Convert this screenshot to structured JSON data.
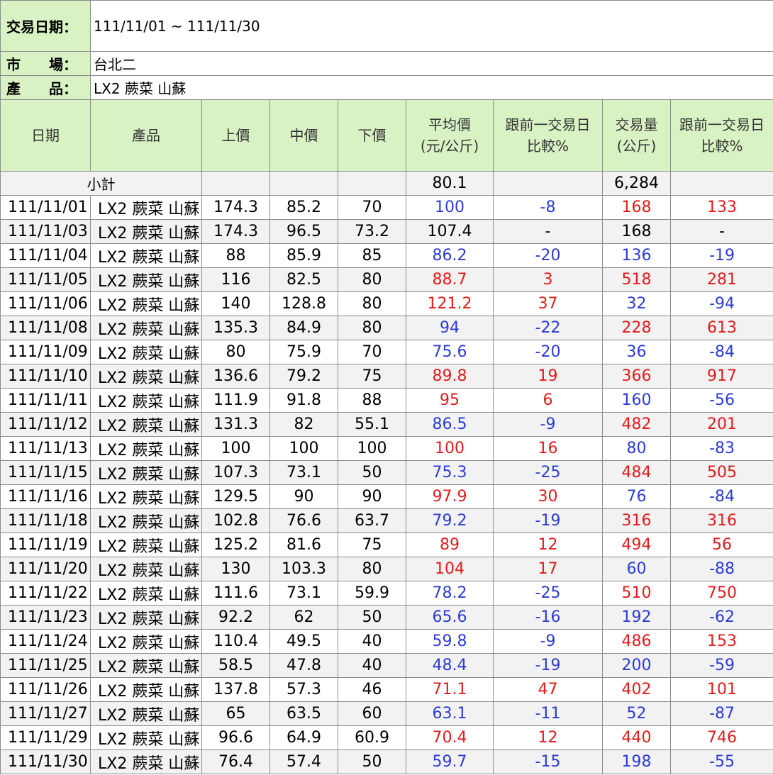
{
  "header": {
    "date_label": "交易日期：",
    "date_value": "111/11/01 ~ 111/11/30",
    "market_label": "市　　場：",
    "market_value": "台北二",
    "product_label": "產　　品：",
    "product_value": "LX2 蕨菜 山蘇"
  },
  "columns": {
    "date": "日期",
    "product": "產品",
    "upper": "上價",
    "middle": "中價",
    "lower": "下價",
    "avg_line1": "平均價",
    "avg_line2": "(元/公斤)",
    "cmp1_line1": "跟前一交易日",
    "cmp1_line2": "比較%",
    "volume_line1": "交易量",
    "volume_line2": "(公斤)",
    "cmp2_line1": "跟前一交易日",
    "cmp2_line2": "比較%"
  },
  "subtotal": {
    "label": "小計",
    "avg": "80.1",
    "volume": "6,284"
  },
  "colors": {
    "up": "#e31b1b",
    "down": "#2b3bd6",
    "header_bg": "#d9f2c4"
  },
  "rows": [
    {
      "date": "111/11/01",
      "product": "LX2 蕨菜 山蘇",
      "upper": "174.3",
      "middle": "85.2",
      "lower": "70",
      "avg": "100",
      "avg_c": "dn",
      "cmp1": "-8",
      "cmp1_c": "dn",
      "vol": "168",
      "vol_c": "up",
      "cmp2": "133",
      "cmp2_c": "up"
    },
    {
      "date": "111/11/03",
      "product": "LX2 蕨菜 山蘇",
      "upper": "174.3",
      "middle": "96.5",
      "lower": "73.2",
      "avg": "107.4",
      "avg_c": "nc",
      "cmp1": "-",
      "cmp1_c": "nc",
      "vol": "168",
      "vol_c": "nc",
      "cmp2": "-",
      "cmp2_c": "nc"
    },
    {
      "date": "111/11/04",
      "product": "LX2 蕨菜 山蘇",
      "upper": "88",
      "middle": "85.9",
      "lower": "85",
      "avg": "86.2",
      "avg_c": "dn",
      "cmp1": "-20",
      "cmp1_c": "dn",
      "vol": "136",
      "vol_c": "dn",
      "cmp2": "-19",
      "cmp2_c": "dn"
    },
    {
      "date": "111/11/05",
      "product": "LX2 蕨菜 山蘇",
      "upper": "116",
      "middle": "82.5",
      "lower": "80",
      "avg": "88.7",
      "avg_c": "up",
      "cmp1": "3",
      "cmp1_c": "up",
      "vol": "518",
      "vol_c": "up",
      "cmp2": "281",
      "cmp2_c": "up"
    },
    {
      "date": "111/11/06",
      "product": "LX2 蕨菜 山蘇",
      "upper": "140",
      "middle": "128.8",
      "lower": "80",
      "avg": "121.2",
      "avg_c": "up",
      "cmp1": "37",
      "cmp1_c": "up",
      "vol": "32",
      "vol_c": "dn",
      "cmp2": "-94",
      "cmp2_c": "dn"
    },
    {
      "date": "111/11/08",
      "product": "LX2 蕨菜 山蘇",
      "upper": "135.3",
      "middle": "84.9",
      "lower": "80",
      "avg": "94",
      "avg_c": "dn",
      "cmp1": "-22",
      "cmp1_c": "dn",
      "vol": "228",
      "vol_c": "up",
      "cmp2": "613",
      "cmp2_c": "up"
    },
    {
      "date": "111/11/09",
      "product": "LX2 蕨菜 山蘇",
      "upper": "80",
      "middle": "75.9",
      "lower": "70",
      "avg": "75.6",
      "avg_c": "dn",
      "cmp1": "-20",
      "cmp1_c": "dn",
      "vol": "36",
      "vol_c": "dn",
      "cmp2": "-84",
      "cmp2_c": "dn"
    },
    {
      "date": "111/11/10",
      "product": "LX2 蕨菜 山蘇",
      "upper": "136.6",
      "middle": "79.2",
      "lower": "75",
      "avg": "89.8",
      "avg_c": "up",
      "cmp1": "19",
      "cmp1_c": "up",
      "vol": "366",
      "vol_c": "up",
      "cmp2": "917",
      "cmp2_c": "up"
    },
    {
      "date": "111/11/11",
      "product": "LX2 蕨菜 山蘇",
      "upper": "111.9",
      "middle": "91.8",
      "lower": "88",
      "avg": "95",
      "avg_c": "up",
      "cmp1": "6",
      "cmp1_c": "up",
      "vol": "160",
      "vol_c": "dn",
      "cmp2": "-56",
      "cmp2_c": "dn"
    },
    {
      "date": "111/11/12",
      "product": "LX2 蕨菜 山蘇",
      "upper": "131.3",
      "middle": "82",
      "lower": "55.1",
      "avg": "86.5",
      "avg_c": "dn",
      "cmp1": "-9",
      "cmp1_c": "dn",
      "vol": "482",
      "vol_c": "up",
      "cmp2": "201",
      "cmp2_c": "up"
    },
    {
      "date": "111/11/13",
      "product": "LX2 蕨菜 山蘇",
      "upper": "100",
      "middle": "100",
      "lower": "100",
      "avg": "100",
      "avg_c": "up",
      "cmp1": "16",
      "cmp1_c": "up",
      "vol": "80",
      "vol_c": "dn",
      "cmp2": "-83",
      "cmp2_c": "dn"
    },
    {
      "date": "111/11/15",
      "product": "LX2 蕨菜 山蘇",
      "upper": "107.3",
      "middle": "73.1",
      "lower": "50",
      "avg": "75.3",
      "avg_c": "dn",
      "cmp1": "-25",
      "cmp1_c": "dn",
      "vol": "484",
      "vol_c": "up",
      "cmp2": "505",
      "cmp2_c": "up"
    },
    {
      "date": "111/11/16",
      "product": "LX2 蕨菜 山蘇",
      "upper": "129.5",
      "middle": "90",
      "lower": "90",
      "avg": "97.9",
      "avg_c": "up",
      "cmp1": "30",
      "cmp1_c": "up",
      "vol": "76",
      "vol_c": "dn",
      "cmp2": "-84",
      "cmp2_c": "dn"
    },
    {
      "date": "111/11/18",
      "product": "LX2 蕨菜 山蘇",
      "upper": "102.8",
      "middle": "76.6",
      "lower": "63.7",
      "avg": "79.2",
      "avg_c": "dn",
      "cmp1": "-19",
      "cmp1_c": "dn",
      "vol": "316",
      "vol_c": "up",
      "cmp2": "316",
      "cmp2_c": "up"
    },
    {
      "date": "111/11/19",
      "product": "LX2 蕨菜 山蘇",
      "upper": "125.2",
      "middle": "81.6",
      "lower": "75",
      "avg": "89",
      "avg_c": "up",
      "cmp1": "12",
      "cmp1_c": "up",
      "vol": "494",
      "vol_c": "up",
      "cmp2": "56",
      "cmp2_c": "up"
    },
    {
      "date": "111/11/20",
      "product": "LX2 蕨菜 山蘇",
      "upper": "130",
      "middle": "103.3",
      "lower": "80",
      "avg": "104",
      "avg_c": "up",
      "cmp1": "17",
      "cmp1_c": "up",
      "vol": "60",
      "vol_c": "dn",
      "cmp2": "-88",
      "cmp2_c": "dn"
    },
    {
      "date": "111/11/22",
      "product": "LX2 蕨菜 山蘇",
      "upper": "111.6",
      "middle": "73.1",
      "lower": "59.9",
      "avg": "78.2",
      "avg_c": "dn",
      "cmp1": "-25",
      "cmp1_c": "dn",
      "vol": "510",
      "vol_c": "up",
      "cmp2": "750",
      "cmp2_c": "up"
    },
    {
      "date": "111/11/23",
      "product": "LX2 蕨菜 山蘇",
      "upper": "92.2",
      "middle": "62",
      "lower": "50",
      "avg": "65.6",
      "avg_c": "dn",
      "cmp1": "-16",
      "cmp1_c": "dn",
      "vol": "192",
      "vol_c": "dn",
      "cmp2": "-62",
      "cmp2_c": "dn"
    },
    {
      "date": "111/11/24",
      "product": "LX2 蕨菜 山蘇",
      "upper": "110.4",
      "middle": "49.5",
      "lower": "40",
      "avg": "59.8",
      "avg_c": "dn",
      "cmp1": "-9",
      "cmp1_c": "dn",
      "vol": "486",
      "vol_c": "up",
      "cmp2": "153",
      "cmp2_c": "up"
    },
    {
      "date": "111/11/25",
      "product": "LX2 蕨菜 山蘇",
      "upper": "58.5",
      "middle": "47.8",
      "lower": "40",
      "avg": "48.4",
      "avg_c": "dn",
      "cmp1": "-19",
      "cmp1_c": "dn",
      "vol": "200",
      "vol_c": "dn",
      "cmp2": "-59",
      "cmp2_c": "dn"
    },
    {
      "date": "111/11/26",
      "product": "LX2 蕨菜 山蘇",
      "upper": "137.8",
      "middle": "57.3",
      "lower": "46",
      "avg": "71.1",
      "avg_c": "up",
      "cmp1": "47",
      "cmp1_c": "up",
      "vol": "402",
      "vol_c": "up",
      "cmp2": "101",
      "cmp2_c": "up"
    },
    {
      "date": "111/11/27",
      "product": "LX2 蕨菜 山蘇",
      "upper": "65",
      "middle": "63.5",
      "lower": "60",
      "avg": "63.1",
      "avg_c": "dn",
      "cmp1": "-11",
      "cmp1_c": "dn",
      "vol": "52",
      "vol_c": "dn",
      "cmp2": "-87",
      "cmp2_c": "dn"
    },
    {
      "date": "111/11/29",
      "product": "LX2 蕨菜 山蘇",
      "upper": "96.6",
      "middle": "64.9",
      "lower": "60.9",
      "avg": "70.4",
      "avg_c": "up",
      "cmp1": "12",
      "cmp1_c": "up",
      "vol": "440",
      "vol_c": "up",
      "cmp2": "746",
      "cmp2_c": "up"
    },
    {
      "date": "111/11/30",
      "product": "LX2 蕨菜 山蘇",
      "upper": "76.4",
      "middle": "57.4",
      "lower": "50",
      "avg": "59.7",
      "avg_c": "dn",
      "cmp1": "-15",
      "cmp1_c": "dn",
      "vol": "198",
      "vol_c": "dn",
      "cmp2": "-55",
      "cmp2_c": "dn"
    }
  ]
}
